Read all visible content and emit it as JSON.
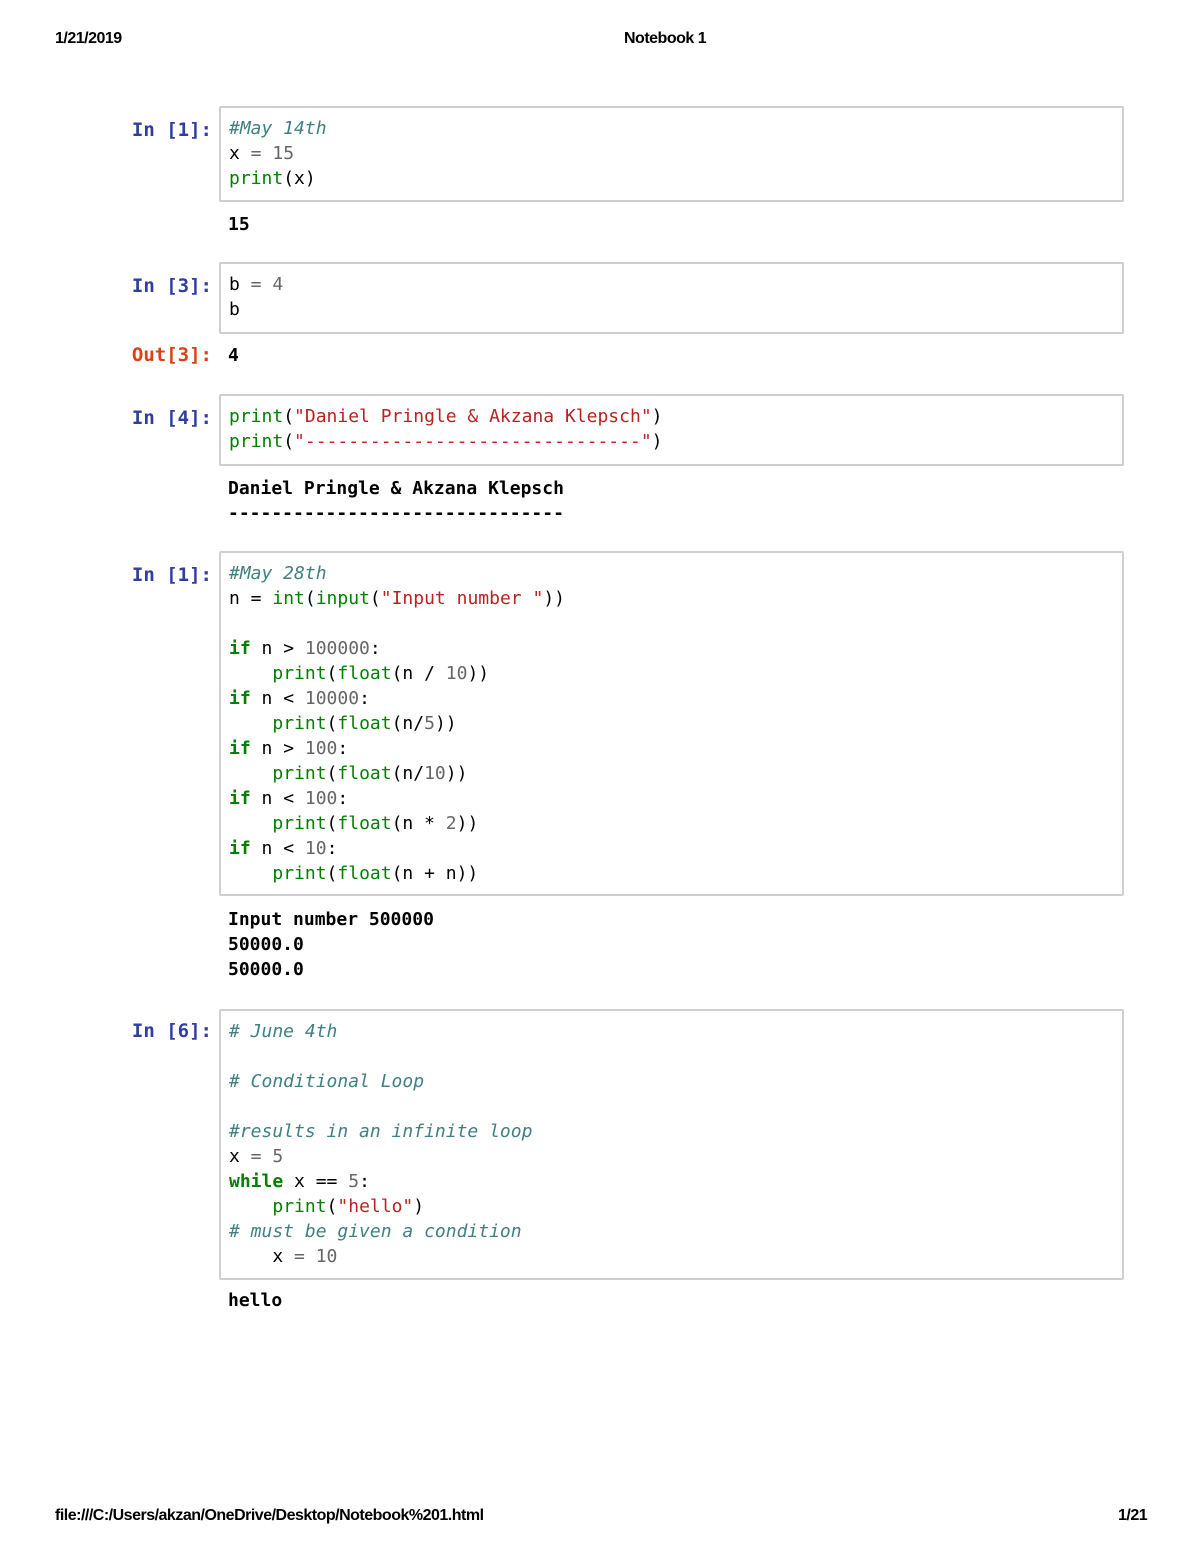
{
  "header": {
    "date": "1/21/2019",
    "title": "Notebook 1"
  },
  "footer": {
    "path": "file:///C:/Users/akzan/OneDrive/Desktop/Notebook%201.html",
    "page": "1/21"
  },
  "cells": [
    {
      "prompt": "In [1]:",
      "output": "15"
    },
    {
      "prompt": "In [3]:",
      "out_prompt": "Out[3]:",
      "output": "4"
    },
    {
      "prompt": "In [4]:",
      "output": "Daniel Pringle & Akzana Klepsch\n-------------------------------"
    },
    {
      "prompt": "In [1]:",
      "output": "Input number 500000\n50000.0\n50000.0"
    },
    {
      "prompt": "In [6]:",
      "output": "hello"
    }
  ],
  "code": {
    "c1": {
      "comment": "#May 14th",
      "l2a": "x",
      "l2b": " = ",
      "l2c": "15",
      "l3a": "print",
      "l3b": "(x)"
    },
    "c3": {
      "l1a": "b",
      "l1b": " = ",
      "l1c": "4",
      "l2": "b"
    },
    "c4": {
      "l1a": "print",
      "l1b": "(",
      "l1c": "\"Daniel Pringle & Akzana Klepsch\"",
      "l1d": ")",
      "l2a": "print",
      "l2b": "(",
      "l2c": "\"-------------------------------\"",
      "l2d": ")"
    },
    "c5": {
      "comment": "#May 28th",
      "l2a": "n = ",
      "l2b": "int",
      "l2c": "(",
      "l2d": "input",
      "l2e": "(",
      "l2f": "\"Input number \"",
      "l2g": "))",
      "if": "if",
      "print": "print",
      "float": "float",
      "i1": " n > ",
      "i1n": "100000",
      "i1e": ":",
      "p1a": "(",
      "p1b": "(n / ",
      "p1n": "10",
      "p1e": "))",
      "i2": " n < ",
      "i2n": "10000",
      "i2e": ":",
      "p2a": "(",
      "p2b": "(n/",
      "p2n": "5",
      "p2e": "))",
      "i3": " n > ",
      "i3n": "100",
      "i3e": ":",
      "p3a": "(",
      "p3b": "(n/",
      "p3n": "10",
      "p3e": "))",
      "i4": " n < ",
      "i4n": "100",
      "i4e": ":",
      "p4a": "(",
      "p4b": "(n * ",
      "p4n": "2",
      "p4e": "))",
      "i5": " n < ",
      "i5n": "10",
      "i5e": ":",
      "p5a": "(",
      "p5b": "(n + n))"
    },
    "c6": {
      "cm1": "# June 4th",
      "cm2": "# Conditional Loop",
      "cm3": "#results in an infinite loop",
      "l4a": "x",
      "l4b": " = ",
      "l4c": "5",
      "l5a": "while",
      "l5b": " x == ",
      "l5c": "5",
      "l5d": ":",
      "l6a": "print",
      "l6b": "(",
      "l6c": "\"hello\"",
      "l6d": ")",
      "cm4": "# must be given a condition",
      "l8a": "x",
      "l8b": " = ",
      "l8c": "10"
    }
  }
}
